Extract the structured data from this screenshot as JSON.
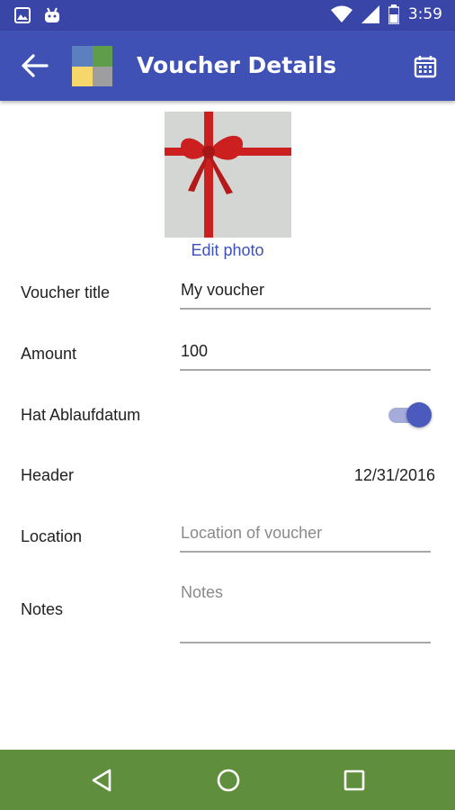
{
  "status_bar": {
    "time": "3:59",
    "icons": [
      "image-notification-icon",
      "android-notification-icon",
      "wifi-icon",
      "signal-icon",
      "battery-icon"
    ]
  },
  "app_bar": {
    "title": "Voucher Details",
    "icons": [
      "back-arrow-icon",
      "app-logo",
      "calendar-icon"
    ]
  },
  "photo": {
    "edit_label": "Edit photo"
  },
  "form": {
    "voucher_title": {
      "label": "Voucher title",
      "value": "My voucher"
    },
    "amount": {
      "label": "Amount",
      "value": "100"
    },
    "expiry": {
      "label": "Hat Ablaufdatum",
      "enabled": true
    },
    "header": {
      "label": "Header",
      "value": "12/31/2016"
    },
    "location": {
      "label": "Location",
      "value": "",
      "placeholder": "Location of voucher"
    },
    "notes": {
      "label": "Notes",
      "value": "",
      "placeholder": "Notes"
    }
  },
  "nav_bar": {
    "icons": [
      "back-triangle-icon",
      "home-circle-icon",
      "recents-square-icon"
    ]
  },
  "colors": {
    "status_bar": "#3a45a8",
    "app_bar": "#3f51b5",
    "accent": "#3f51b5",
    "nav_bar": "#5f8f3c",
    "ribbon": "#cc1f1f"
  }
}
